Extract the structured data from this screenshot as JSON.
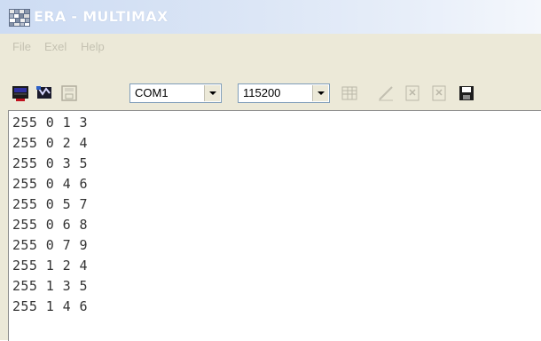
{
  "window": {
    "title": "ERA - MULTIMAX"
  },
  "menu": {
    "items": [
      "File",
      "Exel",
      "Help"
    ]
  },
  "toolbar": {
    "buttons": [
      "connect-icon",
      "disconnect-icon",
      "save-icon",
      "table-icon",
      "graph-icon",
      "export-icon",
      "clear-icon",
      "floppy-icon"
    ],
    "port_value": "COM1",
    "baud_value": "115200"
  },
  "output": {
    "lines": [
      "255 0 1 3",
      "255 0 2 4",
      "255 0 3 5",
      "255 0 4 6",
      "255 0 5 7",
      "255 0 6 8",
      "255 0 7 9",
      "255 1 2 4",
      "255 1 3 5",
      "255 1 4 6"
    ]
  }
}
